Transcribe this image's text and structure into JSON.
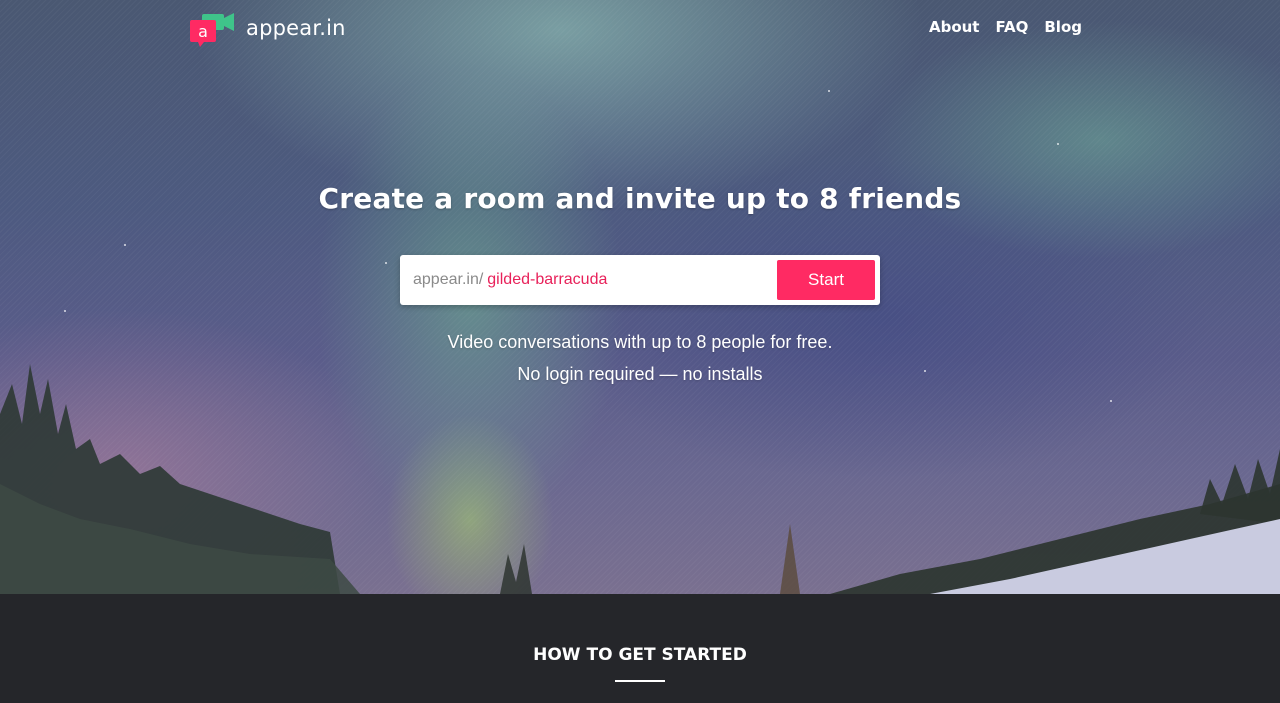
{
  "brand": {
    "name": "appear.in",
    "logo_letter": "a"
  },
  "nav": {
    "items": [
      {
        "label": "About"
      },
      {
        "label": "FAQ"
      },
      {
        "label": "Blog"
      }
    ]
  },
  "hero": {
    "headline": "Create a room and invite up to 8 friends",
    "room_prefix": "appear.in/",
    "room_name": "gilded-barracuda",
    "start_label": "Start",
    "tagline_1": "Video conversations with up to 8 people for free.",
    "tagline_2": "No login required — no installs"
  },
  "section": {
    "title": "HOW TO GET STARTED"
  },
  "colors": {
    "accent": "#ff2a63",
    "logo_green": "#3fc48a",
    "footer_bg": "#25262a"
  }
}
